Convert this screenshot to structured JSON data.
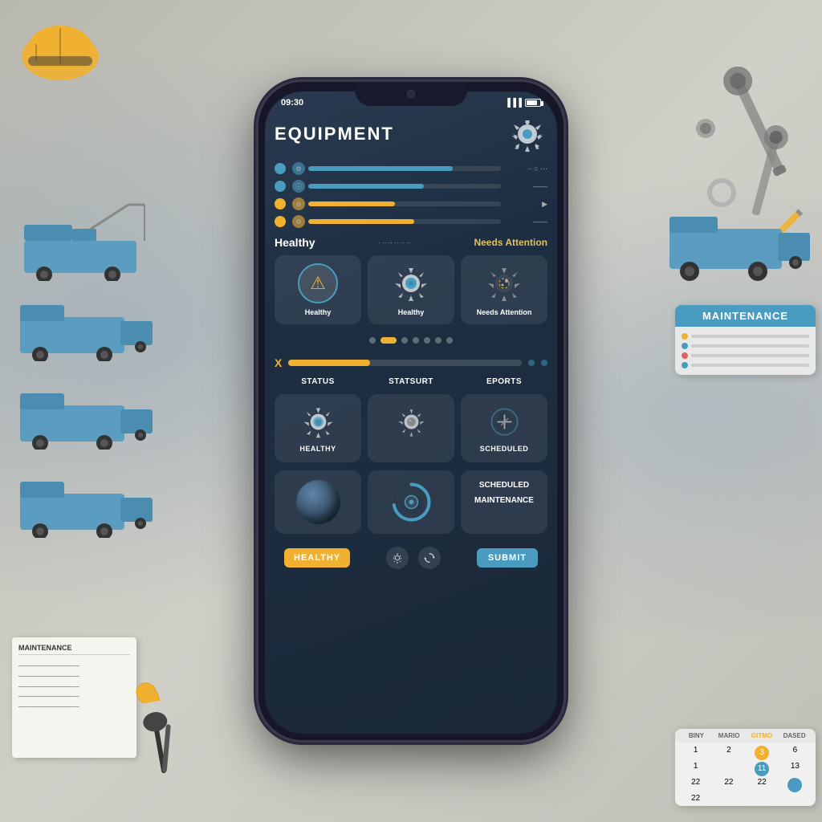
{
  "background": {
    "color": "#c0bfb8"
  },
  "phone": {
    "status_bar": {
      "time": "09:30",
      "battery": "70"
    },
    "header": {
      "title": "EQUIPMENT",
      "gear_icon": "gear-icon"
    },
    "equipment_list": {
      "items": [
        {
          "dot_color": "blue",
          "bar_width": "75%",
          "label": ""
        },
        {
          "dot_color": "blue",
          "bar_width": "60%",
          "label": ""
        },
        {
          "dot_color": "yellow",
          "bar_width": "45%",
          "label": ""
        },
        {
          "dot_color": "yellow",
          "bar_width": "55%",
          "label": ""
        }
      ]
    },
    "status_header": {
      "healthy_label": "Healthy",
      "needs_attention_label": "Needs Attention"
    },
    "equipment_cards": [
      {
        "icon_type": "warning",
        "label": "Healthy"
      },
      {
        "icon_type": "gear",
        "label": "Healthy"
      },
      {
        "icon_type": "gear-worn",
        "label": "Needs Attention"
      }
    ],
    "pagination": {
      "dots": [
        false,
        true,
        false,
        false,
        false,
        false,
        false
      ]
    },
    "progress": {
      "value": 35,
      "label": "X"
    },
    "bottom_section_headers": [
      "STATUS",
      "STATSURT",
      "EPORTS"
    ],
    "bottom_cards": [
      {
        "icon_type": "gear-spin",
        "label": "Healthy"
      },
      {
        "icon_type": "gear-large",
        "label": ""
      },
      {
        "icon_type": "link",
        "label": "Scheduled"
      }
    ],
    "scheduled_maintenance": {
      "line1": "SCHEDULED",
      "line2": "MAINTENANCE"
    },
    "footer": {
      "healthy_badge": "HEALTHY",
      "submit_button": "SUBMIT"
    }
  },
  "right_panel": {
    "maintenance_title": "MAINTENANCE",
    "calendar_headers": [
      "BINY",
      "MARIO",
      "GITMO",
      "DASED"
    ],
    "calendar_rows": [
      [
        "1",
        "2",
        "3",
        "6"
      ],
      [
        "1",
        "",
        "11",
        "13"
      ],
      [
        "22",
        "22",
        "22",
        ""
      ],
      [
        "22",
        "",
        "",
        ""
      ]
    ]
  }
}
